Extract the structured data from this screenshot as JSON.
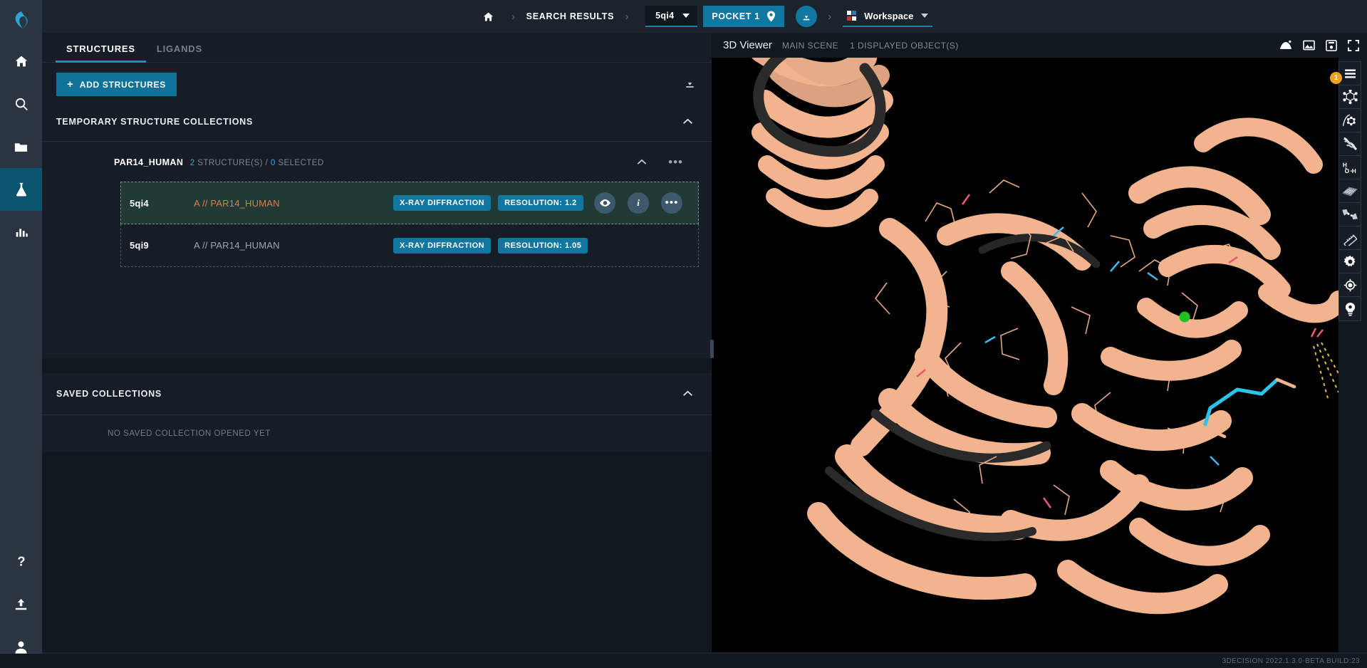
{
  "app": {
    "logo_icon": "3decision-logo-icon",
    "status_version": "3DECISION 2022.1.3.0-BETA BUILD:23"
  },
  "rail": {
    "items": [
      {
        "icon": "home-icon",
        "name": "home"
      },
      {
        "icon": "search-icon",
        "name": "search"
      },
      {
        "icon": "folder-icon",
        "name": "projects"
      },
      {
        "icon": "flask-icon",
        "name": "structures",
        "active": true
      },
      {
        "icon": "chart-bar-icon",
        "name": "analytics"
      }
    ],
    "bottom_items": [
      {
        "icon": "help-icon",
        "name": "help"
      },
      {
        "icon": "upload-icon",
        "name": "import"
      },
      {
        "icon": "user-icon",
        "name": "account"
      }
    ]
  },
  "topbar": {
    "home_icon": "home-icon",
    "separator": "›",
    "breadcrumb": "SEARCH RESULTS",
    "structure_select": {
      "value": "5qi4",
      "icon": "chevron-down-icon"
    },
    "pocket_button": {
      "label": "POCKET 1",
      "icon": "map-pin-icon"
    },
    "download_icon": "download-circle-icon",
    "workspace": {
      "label": "Workspace",
      "icon": "grid-icon",
      "chevron": "chevron-down-icon"
    }
  },
  "left_panel": {
    "tabs": [
      {
        "label": "STRUCTURES",
        "active": true
      },
      {
        "label": "LIGANDS",
        "active": false
      }
    ],
    "add_button": {
      "label": "ADD STRUCTURES",
      "plus": "+"
    },
    "download_icon": "download-icon",
    "temporary_section": {
      "title": "TEMPORARY STRUCTURE COLLECTIONS",
      "collapse_icon": "chevron-up-icon"
    },
    "collection": {
      "name": "PAR14_HUMAN",
      "count": "2",
      "count_label": "STRUCTURE(S) /",
      "selected_count": "0",
      "selected_label": "SELECTED",
      "collapse_icon": "chevron-up-icon",
      "more_icon": "more-horizontal-icon"
    },
    "structures": [
      {
        "pdb_id": "5qi4",
        "chain": "A // PAR14_HUMAN",
        "method": "X-RAY DIFFRACTION",
        "resolution": "RESOLUTION: 1.2",
        "selected": true,
        "actions": [
          {
            "name": "visibility-button",
            "icon": "eye-icon",
            "glyph": ""
          },
          {
            "name": "info-button",
            "icon": "info-icon",
            "glyph": "i"
          },
          {
            "name": "more-button",
            "icon": "more-horizontal-icon",
            "glyph": "•••"
          }
        ]
      },
      {
        "pdb_id": "5qi9",
        "chain": "A // PAR14_HUMAN",
        "method": "X-RAY DIFFRACTION",
        "resolution": "RESOLUTION: 1.05",
        "selected": false,
        "actions": []
      }
    ],
    "saved_section": {
      "title": "SAVED COLLECTIONS",
      "collapse_icon": "chevron-up-icon",
      "empty_text": "NO SAVED COLLECTION OPENED YET"
    }
  },
  "viewer": {
    "title": "3D Viewer",
    "scene": "MAIN SCENE",
    "objects": "1 DISPLAYED OBJECT(S)",
    "header_icons": [
      {
        "name": "viewpoint-icon"
      },
      {
        "name": "image-icon"
      },
      {
        "name": "save-icon"
      },
      {
        "name": "fullscreen-icon"
      }
    ],
    "toolbar": [
      {
        "name": "menu-icon",
        "badge": "1"
      },
      {
        "name": "molecule-icon",
        "badge": null
      },
      {
        "name": "ligand-pocket-icon",
        "badge": null
      },
      {
        "name": "ribbon-icon",
        "badge": null
      },
      {
        "name": "water-icon",
        "badge": null
      },
      {
        "name": "surface-icon",
        "badge": null
      },
      {
        "name": "interaction-icon",
        "badge": null
      },
      {
        "name": "ruler-icon",
        "badge": null
      },
      {
        "name": "gear-icon",
        "badge": null
      },
      {
        "name": "target-icon",
        "badge": null
      },
      {
        "name": "lightbulb-icon",
        "badge": null
      }
    ]
  },
  "colors": {
    "accent": "#1176a0",
    "accent_light": "#3fa9d4",
    "selected_row_bg": "#213a36",
    "chain_highlight": "#dd7d4d",
    "badge_orange": "#f0a01e",
    "protein_ribbon": "#f2b48f",
    "ligand_green": "#1fc21f"
  }
}
